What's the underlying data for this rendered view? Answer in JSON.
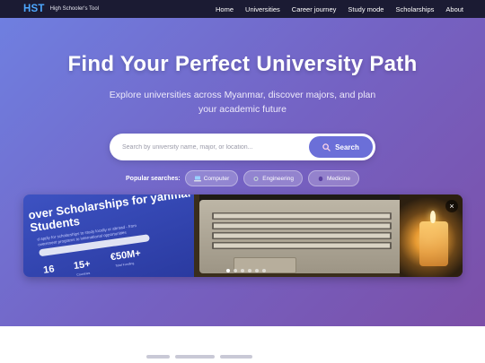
{
  "nav": {
    "logo": "HST",
    "tagline": "High Schooler's Tool",
    "links": [
      "Home",
      "Universities",
      "Career journey",
      "Study mode",
      "Scholarships",
      "About"
    ]
  },
  "hero": {
    "title": "Find Your Perfect University Path",
    "subtitle": "Explore universities across Myanmar, discover majors, and plan your academic future"
  },
  "search": {
    "placeholder": "Search by university name, major, or location...",
    "button_label": "Search",
    "icon": "search-icon"
  },
  "popular": {
    "label": "Popular searches:",
    "chips": [
      {
        "label": "Computer",
        "icon": "laptop-icon"
      },
      {
        "label": "Engineering",
        "icon": "gear-icon"
      },
      {
        "label": "Medicine",
        "icon": "medicine-icon"
      }
    ]
  },
  "carousel": {
    "close_label": "×",
    "slides": 6,
    "active_slide": 0,
    "slide": {
      "title": "over Scholarships for yanmar Students",
      "description": "d apply for scholarships to study locally or abroad - from overnment programs to international opportunities",
      "stats": [
        {
          "value": "16",
          "label": ""
        },
        {
          "value": "15+",
          "label": "Countries"
        },
        {
          "value": "€50M+",
          "label": "Total Funding"
        }
      ]
    }
  },
  "colors": {
    "nav_bg": "#1b1b33",
    "logo": "#4ea8ff",
    "hero_start": "#6f7fe0",
    "hero_end": "#7c4fa8",
    "search_button": "#6b6fd8"
  }
}
